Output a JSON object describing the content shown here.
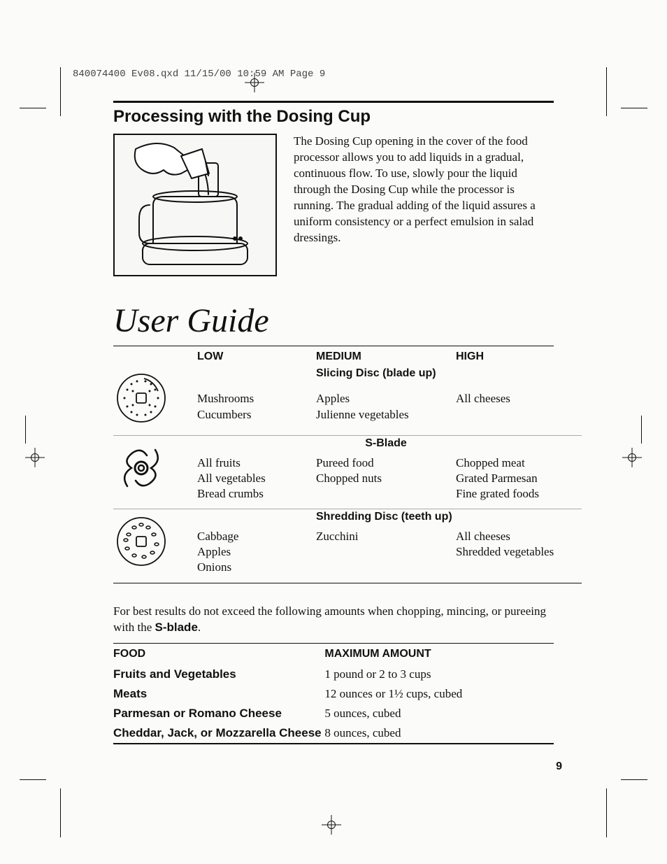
{
  "scanmeta": "840074400 Ev08.qxd  11/15/00  10:59 AM  Page 9",
  "section_title": "Processing with the Dosing Cup",
  "intro_text": "The Dosing Cup opening in the cover of the food processor allows you to add liquids in a gradual, continuous flow. To use, slowly pour the liquid through the Dosing Cup while the processor is running. The gradual adding of the liquid assures a uniform consistency or a perfect emulsion in salad dressings.",
  "user_guide_heading": "User Guide",
  "speed_headers": {
    "low": "LOW",
    "medium": "MEDIUM",
    "high": "HIGH"
  },
  "rows": [
    {
      "subtitle": "Slicing Disc (blade up)",
      "low": "Mushrooms\nCucumbers",
      "medium": "Apples\nJulienne vegetables",
      "high": "All cheeses"
    },
    {
      "subtitle": "S-Blade",
      "low": "All fruits\nAll vegetables\nBread crumbs",
      "medium": "Pureed food\nChopped nuts",
      "high": "Chopped meat\nGrated Parmesan\nFine grated foods"
    },
    {
      "subtitle": "Shredding Disc (teeth up)",
      "low": "Cabbage\nApples\nOnions",
      "medium": "Zucchini",
      "high": "All cheeses\nShredded vegetables"
    }
  ],
  "note_prefix": "For best results do not exceed the following amounts when chopping, mincing, or pureeing with the ",
  "note_bold": "S-blade",
  "note_suffix": ".",
  "max_table": {
    "header_food": "FOOD",
    "header_amount": "MAXIMUM AMOUNT",
    "rows": [
      {
        "food": "Fruits and Vegetables",
        "amount": "1 pound or 2 to 3 cups"
      },
      {
        "food": "Meats",
        "amount": "12 ounces or 1½ cups, cubed"
      },
      {
        "food": "Parmesan or Romano Cheese",
        "amount": "5 ounces, cubed"
      },
      {
        "food": "Cheddar, Jack, or Mozzarella Cheese",
        "amount": "8 ounces, cubed"
      }
    ]
  },
  "page_number": "9"
}
